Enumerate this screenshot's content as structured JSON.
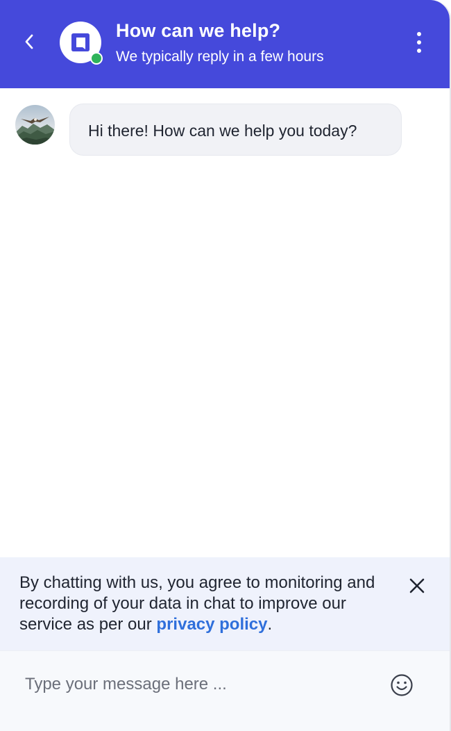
{
  "header": {
    "title": "How can we help?",
    "subtitle": "We typically reply in a few hours",
    "background_color": "#4549db",
    "status_color": "#2fb35b",
    "back_icon": "chevron-left-icon",
    "menu_icon": "kebab-menu-icon",
    "logo_icon": "chat-logo-icon"
  },
  "conversation": {
    "messages": [
      {
        "sender": "agent",
        "avatar": "agent-avatar-landscape",
        "text": "Hi there! How can we help you today?"
      }
    ]
  },
  "consent": {
    "text_before": "By chatting with us, you agree to monitoring and recording of your data in chat to improve our service as per our ",
    "link_label": "privacy policy",
    "text_after": ".",
    "link_color": "#2f6fdb",
    "close_icon": "close-icon"
  },
  "composer": {
    "placeholder": "Type your message here ...",
    "value": "",
    "emoji_icon": "smiley-icon"
  }
}
